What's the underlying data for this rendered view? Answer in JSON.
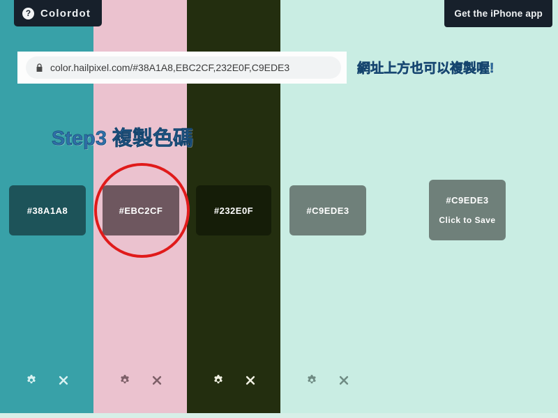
{
  "app": {
    "brand": "Colordot",
    "help_icon": "question-mark-icon",
    "iphone_app_button": "Get the iPhone app"
  },
  "browser": {
    "lock_icon": "lock-icon",
    "url": "color.hailpixel.com/#38A1A8,EBC2CF,232E0F,C9EDE3"
  },
  "annotations": {
    "url_note": "網址上方也可以複製喔!",
    "step_note": "Step3 複製色碼",
    "highlight_shape": "red-ellipse-around-second-swatch",
    "highlight_color": "#E01B1B",
    "text_color": "#2F6FA8"
  },
  "palette": {
    "columns": [
      {
        "hex": "#38A1A8",
        "label": "#38A1A8",
        "column_bg": "#38A1A8",
        "chip_bg": "#1D5359"
      },
      {
        "hex": "#EBC2CF",
        "label": "#EBC2CF",
        "column_bg": "#EBC2CF",
        "chip_bg": "#6E575F"
      },
      {
        "hex": "#232E0F",
        "label": "#232E0F",
        "column_bg": "#232E0F",
        "chip_bg": "#151D08"
      },
      {
        "hex": "#C9EDE3",
        "label": "#C9EDE3",
        "column_bg": "#C9EDE3",
        "chip_bg": "#6F807A"
      }
    ],
    "save_chip": {
      "label": "#C9EDE3",
      "action": "Click to Save",
      "chip_bg": "#6F807A"
    },
    "controls": {
      "settings_icon": "gear-icon",
      "remove_icon": "close-x-icon"
    }
  }
}
